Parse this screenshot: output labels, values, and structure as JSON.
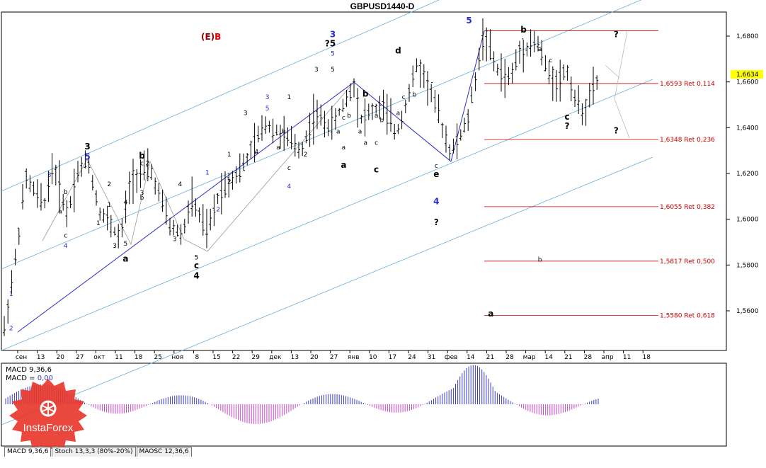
{
  "chart_data": {
    "type": "candlestick-ohlc",
    "title": "GBPUSD1440-D",
    "symbol": "GBPUSD",
    "timeframe": "1440-D",
    "last_price_label": "1,6634",
    "y_ticks": [
      "1,6800",
      "1,6600",
      "1,6400",
      "1,6200",
      "1,6000",
      "1,5800",
      "1,5600"
    ],
    "ylim": [
      1.546,
      1.692
    ],
    "x_tick_labels": [
      "сен",
      "13",
      "20",
      "27",
      "окт",
      "11",
      "18",
      "25",
      "ноя",
      "8",
      "15",
      "22",
      "29",
      "дек",
      "13",
      "20",
      "27",
      "янв",
      "10",
      "17",
      "24",
      "31",
      "фев",
      "14",
      "21",
      "28",
      "мар",
      "14",
      "21",
      "28",
      "апр",
      "11",
      "18"
    ],
    "retracements": [
      {
        "price": 1.6593,
        "label": "1,6593 Ret 0,114"
      },
      {
        "price": 1.6348,
        "label": "1,6348 Ret 0,236"
      },
      {
        "price": 1.6055,
        "label": "1,6055 Ret 0,382"
      },
      {
        "price": 1.5817,
        "label": "1,5817 Ret 0,500"
      },
      {
        "price": 1.558,
        "label": "1,5580 Ret 0,618"
      }
    ],
    "top_line_price": 1.6823,
    "wave_label_main": "(E)",
    "wave_label_sub": "B",
    "wave_labels": [
      {
        "t": "1",
        "day": 1,
        "p": 1.5665,
        "c": "blue"
      },
      {
        "t": "2",
        "day": 1,
        "p": 1.5515,
        "c": "blue"
      },
      {
        "t": "3",
        "day": 8,
        "p": 1.6185,
        "c": "blue"
      },
      {
        "t": "4",
        "day": 11,
        "p": 1.5875,
        "c": "blue"
      },
      {
        "t": "b",
        "day": 11,
        "p": 1.611,
        "c": "black"
      },
      {
        "t": "a",
        "day": 10,
        "p": 1.6025,
        "c": "black"
      },
      {
        "t": "c",
        "day": 11,
        "p": 1.592,
        "c": "black"
      },
      {
        "t": "3",
        "day": 15,
        "p": 1.6305,
        "c": "black",
        "big": true
      },
      {
        "t": "5",
        "day": 15,
        "p": 1.626,
        "c": "blue",
        "big": true
      },
      {
        "t": "1",
        "day": 17,
        "p": 1.5975,
        "c": "black"
      },
      {
        "t": "2",
        "day": 19,
        "p": 1.6145,
        "c": "black"
      },
      {
        "t": "1",
        "day": 19,
        "p": 1.6055,
        "c": "black"
      },
      {
        "t": "3",
        "day": 20,
        "p": 1.5875,
        "c": "black"
      },
      {
        "t": "a",
        "day": 22,
        "p": 1.5815,
        "c": "black",
        "big": true
      },
      {
        "t": "4",
        "day": 22,
        "p": 1.6065,
        "c": "black"
      },
      {
        "t": "5",
        "day": 22,
        "p": 1.5885,
        "c": "black"
      },
      {
        "t": "b",
        "day": 25,
        "p": 1.6265,
        "c": "black",
        "big": true
      },
      {
        "t": "c",
        "day": 25,
        "p": 1.6235,
        "c": "black"
      },
      {
        "t": "2",
        "day": 26,
        "p": 1.6235,
        "c": "black"
      },
      {
        "t": "3",
        "day": 25,
        "p": 1.6105,
        "c": "black"
      },
      {
        "t": "b",
        "day": 25,
        "p": 1.6085,
        "c": "black"
      },
      {
        "t": "4",
        "day": 32,
        "p": 1.6145,
        "c": "black"
      },
      {
        "t": "3",
        "day": 31,
        "p": 1.5905,
        "c": "black"
      },
      {
        "t": "5",
        "day": 35,
        "p": 1.5825,
        "c": "black"
      },
      {
        "t": "c",
        "day": 35,
        "p": 1.5785,
        "c": "black",
        "big": true
      },
      {
        "t": "4",
        "day": 35,
        "p": 1.574,
        "c": "black",
        "big": true
      },
      {
        "t": "1",
        "day": 37,
        "p": 1.6195,
        "c": "blue"
      },
      {
        "t": "2",
        "day": 39,
        "p": 1.6035,
        "c": "blue"
      },
      {
        "t": "1",
        "day": 41,
        "p": 1.6275,
        "c": "black"
      },
      {
        "t": "2",
        "day": 41,
        "p": 1.6155,
        "c": "black"
      },
      {
        "t": "3",
        "day": 44,
        "p": 1.6455,
        "c": "black"
      },
      {
        "t": "4",
        "day": 46,
        "p": 1.6285,
        "c": "black"
      },
      {
        "t": "3",
        "day": 48,
        "p": 1.6525,
        "c": "blue"
      },
      {
        "t": "5",
        "day": 48,
        "p": 1.6475,
        "c": "blue"
      },
      {
        "t": "4",
        "day": 52,
        "p": 1.6135,
        "c": "blue"
      },
      {
        "t": "1",
        "day": 52,
        "p": 1.6525,
        "c": "black"
      },
      {
        "t": "b",
        "day": 51,
        "p": 1.6375,
        "c": "black"
      },
      {
        "t": "a",
        "day": 50,
        "p": 1.6305,
        "c": "black"
      },
      {
        "t": "c",
        "day": 52,
        "p": 1.6215,
        "c": "black"
      },
      {
        "t": "2",
        "day": 55,
        "p": 1.6275,
        "c": "black"
      },
      {
        "t": "3",
        "day": 57,
        "p": 1.6645,
        "c": "black"
      },
      {
        "t": "?",
        "day": 59,
        "p": 1.6755,
        "c": "black",
        "big": true
      },
      {
        "t": "3",
        "day": 60,
        "p": 1.6795,
        "c": "blue",
        "big": true
      },
      {
        "t": "5",
        "day": 60,
        "p": 1.6755,
        "c": "black",
        "big": true
      },
      {
        "t": "5",
        "day": 60,
        "p": 1.6715,
        "c": "blue"
      },
      {
        "t": "5",
        "day": 60,
        "p": 1.6645,
        "c": "black"
      },
      {
        "t": "b",
        "day": 66,
        "p": 1.6535,
        "c": "black",
        "big": true
      },
      {
        "t": "c",
        "day": 62,
        "p": 1.6435,
        "c": "black"
      },
      {
        "t": "a",
        "day": 61,
        "p": 1.6375,
        "c": "black"
      },
      {
        "t": "b",
        "day": 63,
        "p": 1.6445,
        "c": "black"
      },
      {
        "t": "a",
        "day": 62,
        "p": 1.6305,
        "c": "black"
      },
      {
        "t": "a",
        "day": 62,
        "p": 1.6225,
        "c": "black",
        "big": true
      },
      {
        "t": "a",
        "day": 65,
        "p": 1.6375,
        "c": "black"
      },
      {
        "t": "a",
        "day": 66,
        "p": 1.6325,
        "c": "black"
      },
      {
        "t": "c",
        "day": 68,
        "p": 1.6325,
        "c": "black"
      },
      {
        "t": "c",
        "day": 68,
        "p": 1.6205,
        "c": "black",
        "big": true
      },
      {
        "t": "a",
        "day": 68,
        "p": 1.6445,
        "c": "black"
      },
      {
        "t": "b",
        "day": 69,
        "p": 1.6425,
        "c": "black"
      },
      {
        "t": "d",
        "day": 72,
        "p": 1.6725,
        "c": "black",
        "big": true
      },
      {
        "t": "a",
        "day": 72,
        "p": 1.6455,
        "c": "black"
      },
      {
        "t": "c",
        "day": 73,
        "p": 1.6525,
        "c": "black"
      },
      {
        "t": "b",
        "day": 75,
        "p": 1.6535,
        "c": "black"
      },
      {
        "t": "c",
        "day": 79,
        "p": 1.6225,
        "c": "black"
      },
      {
        "t": "e",
        "day": 79,
        "p": 1.6185,
        "c": "black",
        "big": true
      },
      {
        "t": "4",
        "day": 79,
        "p": 1.6065,
        "c": "blue",
        "big": true
      },
      {
        "t": "?",
        "day": 79,
        "p": 1.5975,
        "c": "black",
        "big": true
      },
      {
        "t": "5",
        "day": 85,
        "p": 1.6855,
        "c": "blue",
        "big": true
      },
      {
        "t": "a",
        "day": 89,
        "p": 1.5575,
        "c": "black",
        "big": true
      },
      {
        "t": "b",
        "day": 95,
        "p": 1.6815,
        "c": "black",
        "big": true
      },
      {
        "t": "a",
        "day": 98,
        "p": 1.6735,
        "c": "black"
      },
      {
        "t": "b",
        "day": 98,
        "p": 1.5815,
        "c": "black"
      },
      {
        "t": "c",
        "day": 100,
        "p": 1.6685,
        "c": "black"
      },
      {
        "t": "c",
        "day": 103,
        "p": 1.6435,
        "c": "black",
        "big": true
      },
      {
        "t": "?",
        "day": 103,
        "p": 1.6395,
        "c": "black",
        "big": true
      },
      {
        "t": "?",
        "day": 112,
        "p": 1.6795,
        "c": "black",
        "big": true
      },
      {
        "t": "?",
        "day": 112,
        "p": 1.6375,
        "c": "black",
        "big": true
      }
    ],
    "macd_label": "MACD 9,36,6",
    "macd_value_label": "MACD = ",
    "macd_value": "0,00",
    "indicator_tabs": [
      "MACD 9,36,6",
      "Stoch 13,3,3 (80%-20%)",
      "MAOSC 12,36,6"
    ],
    "colors": {
      "grid": "#000000",
      "channel": "#6aaedb",
      "wave_line": "#2c2cc8",
      "gray_line": "#9a9a9a",
      "retrace": "#cc0000",
      "hist_pos": "#3a3ad0",
      "hist_neg": "#cc44cc",
      "accent": "#e8372c"
    }
  },
  "branding": {
    "logo_text": "InstaForex"
  }
}
